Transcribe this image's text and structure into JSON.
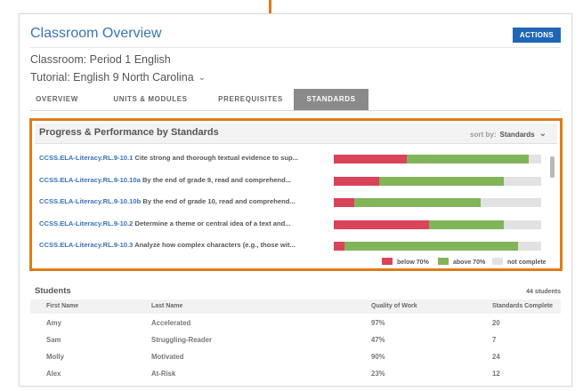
{
  "header": {
    "title": "Classroom Overview",
    "actions_label": "ACTIONS"
  },
  "classroom": {
    "label": "Classroom: Period 1 English",
    "tutorial": "Tutorial: English 9 North Carolina"
  },
  "tabs": [
    {
      "label": "OVERVIEW",
      "active": false
    },
    {
      "label": "UNITS & MODULES",
      "active": false
    },
    {
      "label": "PREREQUISITES",
      "active": false
    },
    {
      "label": "STANDARDS",
      "active": true
    }
  ],
  "standards_panel": {
    "title": "Progress & Performance by Standards",
    "sort_label": "sort by:",
    "sort_value": "Standards",
    "rows": [
      {
        "code": "CCSS.ELA-Literacy.RL.9-10.1",
        "description": "Cite strong and thorough textual evidence to sup...",
        "below70": 0.35,
        "above70": 0.59,
        "not_complete": 0.06
      },
      {
        "code": "CCSS.ELA-Literacy.RL.9-10.10a",
        "description": "By the end of grade 9, read and comprehend...",
        "below70": 0.22,
        "above70": 0.6,
        "not_complete": 0.18
      },
      {
        "code": "CCSS.ELA-Literacy.RL.9-10.10b",
        "description": "By the end of grade 10, read and comprehend...",
        "below70": 0.1,
        "above70": 0.61,
        "not_complete": 0.29
      },
      {
        "code": "CCSS.ELA-Literacy.RL.9-10.2",
        "description": "Determine a theme or central idea of a text and...",
        "below70": 0.46,
        "above70": 0.36,
        "not_complete": 0.18
      },
      {
        "code": "CCSS.ELA-Literacy.RL.9-10.3",
        "description": "Analyze how complex characters (e.g., those wit...",
        "below70": 0.05,
        "above70": 0.84,
        "not_complete": 0.11
      }
    ],
    "legend": [
      {
        "label": "below 70%",
        "color": "#d9445a"
      },
      {
        "label": "above 70%",
        "color": "#82b45a"
      },
      {
        "label": "not complete",
        "color": "#e2e2e2"
      }
    ]
  },
  "students": {
    "title": "Students",
    "count": "44 students",
    "columns": [
      "First Name",
      "Last Name",
      "Quality of Work",
      "Standards Complete"
    ],
    "rows": [
      [
        "Amy",
        "Accelerated",
        "97%",
        "20"
      ],
      [
        "Sam",
        "Struggling-Reader",
        "47%",
        "7"
      ],
      [
        "Molly",
        "Motivated",
        "90%",
        "24"
      ],
      [
        "Alex",
        "At-Risk",
        "23%",
        "12"
      ]
    ]
  },
  "colors": {
    "accent": "#2166b6",
    "link": "#3a73b8",
    "callout": "#e07b1a"
  }
}
